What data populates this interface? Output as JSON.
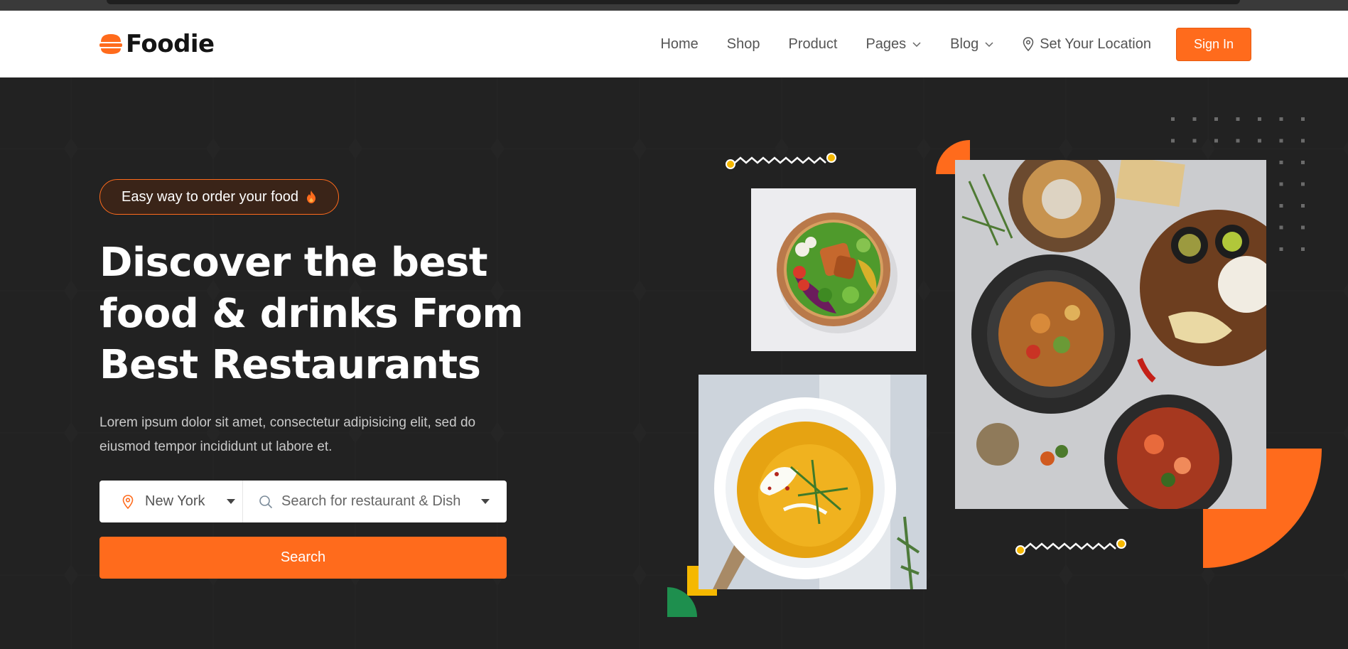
{
  "brand": {
    "name": "Foodie",
    "accent": "#ff6b1c",
    "background": "#222222"
  },
  "nav": {
    "items": [
      {
        "label": "Home",
        "dropdown": false
      },
      {
        "label": "Shop",
        "dropdown": false
      },
      {
        "label": "Product",
        "dropdown": false
      },
      {
        "label": "Pages",
        "dropdown": true
      },
      {
        "label": "Blog",
        "dropdown": true
      }
    ],
    "location_link": "Set Your Location",
    "sign_in": "Sign In"
  },
  "hero": {
    "badge": "Easy way to order your food",
    "badge_icon": "flame-icon",
    "headline": [
      "Discover the best",
      "food & drinks From",
      "Best Restaurants"
    ],
    "description": "Lorem ipsum dolor sit amet, consectetur adipisicing elit, sed do eiusmod tempor incididunt ut labore et.",
    "search": {
      "city": "New York",
      "placeholder": "Search for restaurant & Dish",
      "button": "Search"
    }
  },
  "images": [
    {
      "name": "salad-bowl-photo"
    },
    {
      "name": "pumpkin-soup-photo"
    },
    {
      "name": "food-platter-photo"
    }
  ]
}
